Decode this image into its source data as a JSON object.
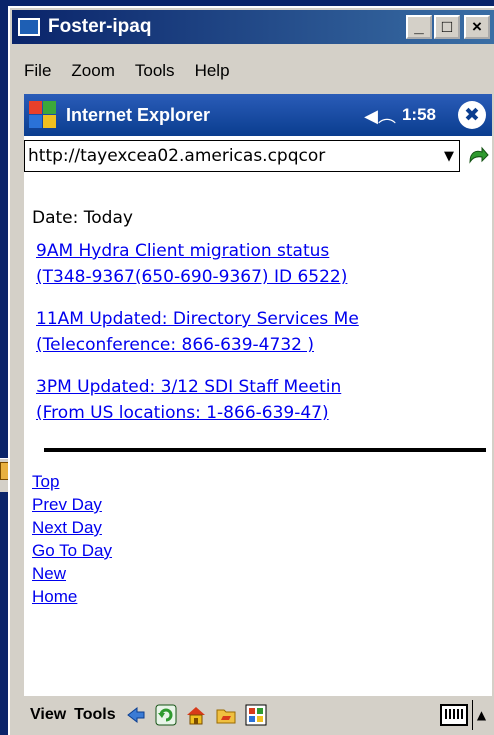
{
  "window": {
    "title": "Foster-ipaq",
    "controls": [
      "_",
      "□",
      "×"
    ]
  },
  "menubar": {
    "items": [
      "File",
      "Zoom",
      "Tools",
      "Help"
    ]
  },
  "pocket": {
    "app_title": "Internet Explorer",
    "time": "1:58",
    "icons": [
      "windows-logo-icon",
      "speaker-icon",
      "close-icon"
    ]
  },
  "address": {
    "url": "http://tayexcea02.americas.cpqcor"
  },
  "content": {
    "date_label": "Date: Today",
    "events": [
      {
        "line1": "9AM Hydra Client migration status ",
        "line2": "(T348-9367(650-690-9367) ID 6522)"
      },
      {
        "line1": "11AM Updated: Directory Services Me ",
        "line2": "(Teleconference: 866-639-4732 )"
      },
      {
        "line1": "3PM Updated: 3/12 SDI Staff Meetin ",
        "line2": "(From US locations: 1-866-639-47)"
      }
    ],
    "nav": [
      "Top",
      "Prev Day",
      "Next Day",
      "Go To Day",
      "New",
      "Home"
    ]
  },
  "bottom_bar": {
    "view_label": "View",
    "tools_label": "Tools",
    "icons": [
      "back-icon",
      "refresh-icon",
      "home-icon",
      "favorites-icon",
      "view-icon",
      "keyboard-icon",
      "up-arrow-icon"
    ]
  },
  "colors": {
    "title_bar": "#0a246a",
    "link": "#0000ee",
    "pocket_bar": "#0a3d8f"
  }
}
